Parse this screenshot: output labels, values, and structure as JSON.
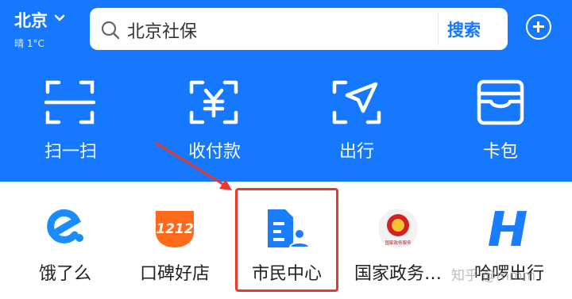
{
  "header": {
    "city": "北京",
    "weather": "晴 1°C",
    "search_text": "北京社保",
    "search_button": "搜索"
  },
  "main_actions": [
    {
      "label": "扫一扫",
      "icon": "scan-icon"
    },
    {
      "label": "收付款",
      "icon": "payment-icon"
    },
    {
      "label": "出行",
      "icon": "travel-icon"
    },
    {
      "label": "卡包",
      "icon": "card-wallet-icon"
    }
  ],
  "apps": [
    {
      "label": "饿了么",
      "icon": "eleme-icon"
    },
    {
      "label": "口碑好店",
      "icon": "koubei-icon",
      "badge": "1212"
    },
    {
      "label": "市民中心",
      "icon": "citizen-center-icon"
    },
    {
      "label": "国家政务…",
      "icon": "national-gov-icon",
      "badge": "国家政务服务"
    },
    {
      "label": "哈啰出行",
      "icon": "hellobike-icon"
    }
  ],
  "watermark": "知乎 @mmm",
  "colors": {
    "brand_blue": "#1677ff",
    "highlight_red": "#e8392b"
  }
}
